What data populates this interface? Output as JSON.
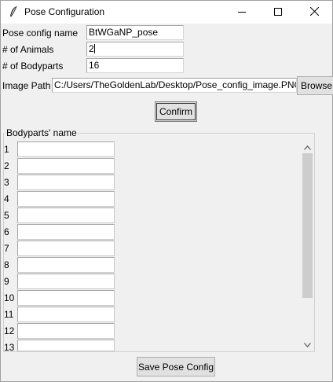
{
  "window": {
    "title": "Pose Configuration",
    "icon": "feather-icon",
    "controls": [
      "minimize-icon",
      "maximize-icon",
      "close-icon"
    ]
  },
  "form": {
    "config_name_label": "Pose config name",
    "config_name_value": "BtWGaNP_pose",
    "animals_label": "# of Animals",
    "animals_value": "2",
    "bodyparts_label": "# of Bodyparts",
    "bodyparts_value": "16",
    "image_path_label": "Image Path",
    "image_path_value": "C:/Users/TheGoldenLab/Desktop/Pose_config_image.PNG",
    "browse_label": "Browse",
    "confirm_label": "Confirm"
  },
  "bodyparts": {
    "title": "Bodyparts' name",
    "rows": [
      {
        "num": "1",
        "value": ""
      },
      {
        "num": "2",
        "value": ""
      },
      {
        "num": "3",
        "value": ""
      },
      {
        "num": "4",
        "value": ""
      },
      {
        "num": "5",
        "value": ""
      },
      {
        "num": "6",
        "value": ""
      },
      {
        "num": "7",
        "value": ""
      },
      {
        "num": "8",
        "value": ""
      },
      {
        "num": "9",
        "value": ""
      },
      {
        "num": "10",
        "value": ""
      },
      {
        "num": "11",
        "value": ""
      },
      {
        "num": "12",
        "value": ""
      },
      {
        "num": "13",
        "value": ""
      }
    ]
  },
  "footer": {
    "save_label": "Save Pose Config"
  }
}
